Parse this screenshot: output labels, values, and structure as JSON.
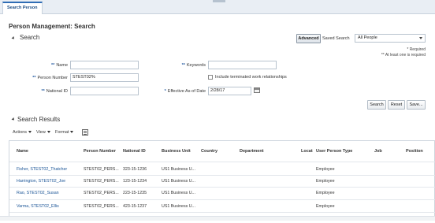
{
  "tabs": [
    {
      "label": "Search Person"
    }
  ],
  "page": {
    "title": "Person Management: Search"
  },
  "search": {
    "section_title": "Search",
    "advanced_label": "Advanced",
    "saved_search_label": "Saved Search",
    "saved_search_value": "All People",
    "required_note": "* Required",
    "at_least_one_note": "** At least one is required",
    "fields": {
      "name": {
        "label": "Name",
        "required": "**",
        "value": ""
      },
      "person_number": {
        "label": "Person Number",
        "required": "**",
        "value": "STEST02%"
      },
      "national_id": {
        "label": "National ID",
        "required": "**",
        "value": ""
      },
      "keywords": {
        "label": "Keywords",
        "required": "**",
        "value": ""
      },
      "include_terminated": {
        "label": "Include terminated work relationships",
        "checked": false
      },
      "effective_as_of": {
        "label": "Effective As-of Date",
        "required": "*",
        "value": "2/28/17"
      }
    },
    "buttons": {
      "search": "Search",
      "reset": "Reset",
      "save": "Save..."
    }
  },
  "results": {
    "section_title": "Search Results",
    "toolbar": {
      "actions": "Actions",
      "view": "View",
      "format": "Format"
    },
    "columns": [
      "Name",
      "Person Number",
      "National ID",
      "Business Unit",
      "Country",
      "Department",
      "Locat",
      "User Person Type",
      "Job",
      "Position"
    ],
    "rows": [
      {
        "name": "Fisher, STEST02_Thatcher",
        "person_number": "STEST02_PERS...",
        "national_id": "323-15-1236",
        "business_unit": "US1 Business U...",
        "user_person_type": "Employee"
      },
      {
        "name": "Harrington, STEST02_Joe",
        "person_number": "STEST02_PERS...",
        "national_id": "123-15-1234",
        "business_unit": "US1 Business U...",
        "user_person_type": "Employee"
      },
      {
        "name": "Rao, STEST02_Susan",
        "person_number": "STEST02_PERS...",
        "national_id": "223-15-1235",
        "business_unit": "US1 Business U...",
        "user_person_type": "Employee"
      },
      {
        "name": "Varma, STEST02_Ellis",
        "person_number": "STEST02_PERS...",
        "national_id": "423-15-1237",
        "business_unit": "US1 Business U...",
        "user_person_type": "Employee"
      }
    ]
  },
  "colors": {
    "accent": "#2f6db5",
    "link": "#1a5496",
    "required": "#2a5fa3"
  }
}
